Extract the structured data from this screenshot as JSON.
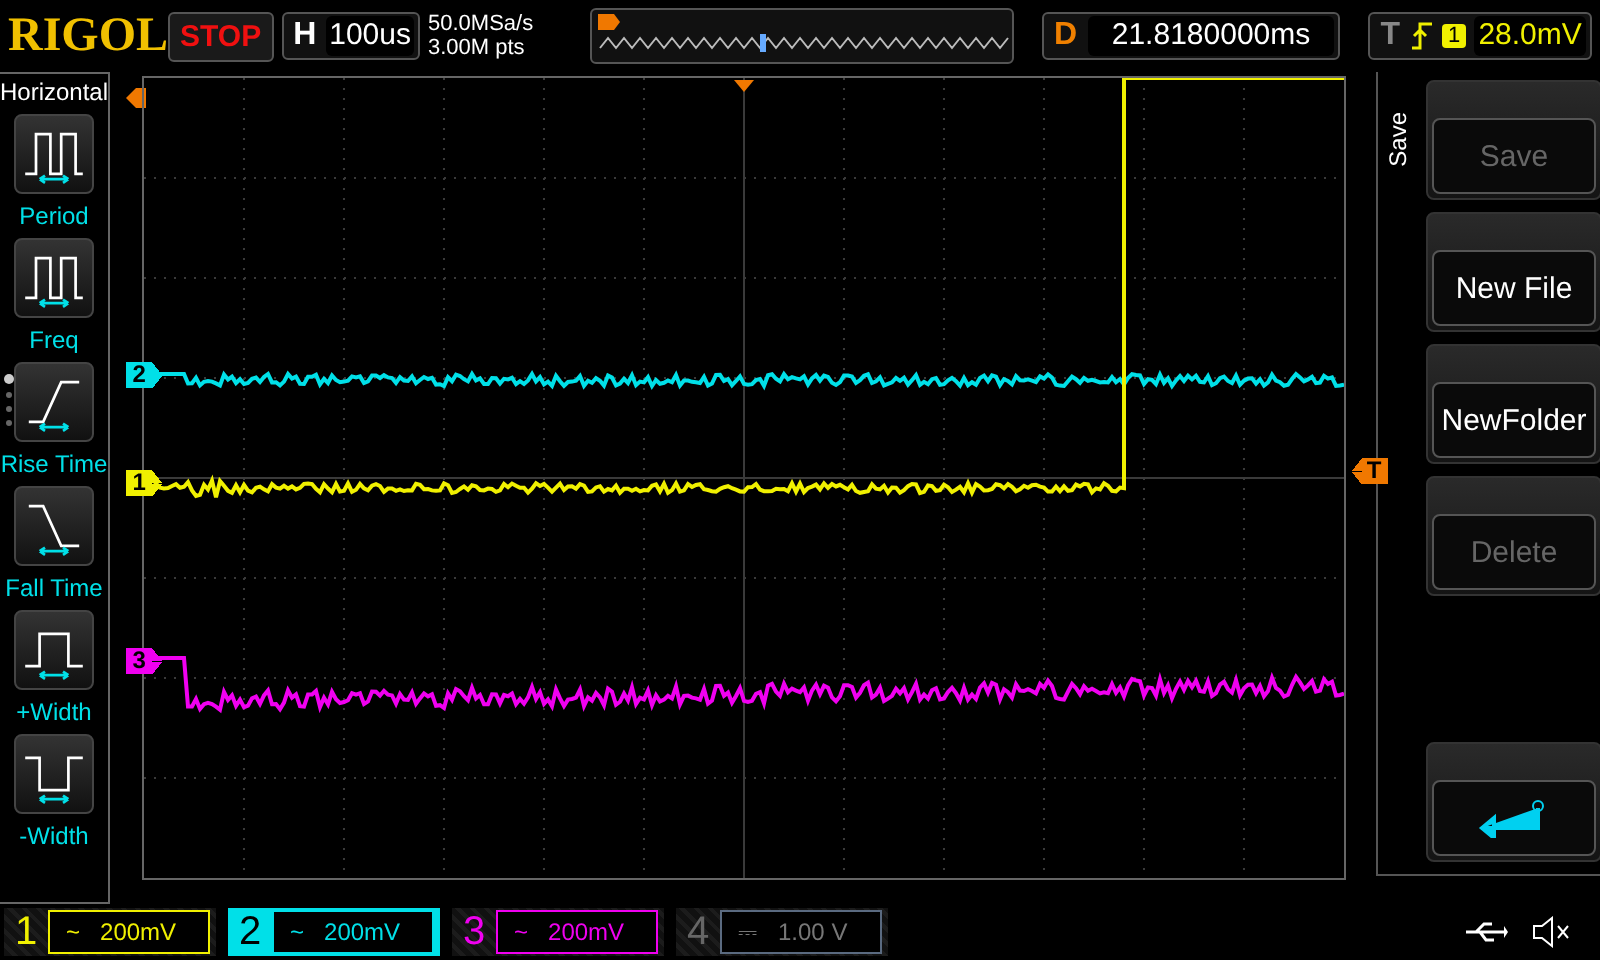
{
  "top_bar": {
    "logo": "RIGOL",
    "run_state": "STOP",
    "timebase": {
      "label": "H",
      "value": "100us"
    },
    "sample_rate": "50.0MSa/s",
    "memory_depth": "3.00M pts",
    "delay": {
      "label": "D",
      "value": "21.8180000ms"
    },
    "trigger": {
      "label": "T",
      "source": "1",
      "level": "28.0mV"
    }
  },
  "measure_panel": {
    "title": "Horizontal",
    "items": [
      {
        "label": "Period",
        "kind": "period"
      },
      {
        "label": "Freq",
        "kind": "freq"
      },
      {
        "label": "Rise Time",
        "kind": "rise"
      },
      {
        "label": "Fall Time",
        "kind": "fall"
      },
      {
        "label": "+Width",
        "kind": "pwidth"
      },
      {
        "label": "-Width",
        "kind": "nwidth"
      }
    ],
    "page_dots": [
      {
        "selected": true
      },
      {
        "selected": false
      },
      {
        "selected": false
      },
      {
        "selected": false
      }
    ]
  },
  "markers": [
    {
      "label": "2",
      "color": "#00e0e8"
    },
    {
      "label": "1",
      "color": "#f0f000"
    },
    {
      "label": "3",
      "color": "#f000f0"
    }
  ],
  "trigger_marker": {
    "label": "T"
  },
  "menu": {
    "title": "Save",
    "buttons": [
      {
        "label": "Save",
        "disabled": true
      },
      {
        "label": "New File",
        "disabled": false
      },
      {
        "label": "NewFolder",
        "disabled": false
      },
      {
        "label": "Delete",
        "disabled": true
      }
    ]
  },
  "channels": [
    {
      "number": "1",
      "coupling": "~",
      "scale": "200mV",
      "color": "#f0f000",
      "selected": false,
      "on": true
    },
    {
      "number": "2",
      "coupling": "~",
      "scale": "200mV",
      "color": "#00e0e8",
      "selected": true,
      "on": true
    },
    {
      "number": "3",
      "coupling": "~",
      "scale": "200mV",
      "color": "#f000f0",
      "selected": false,
      "on": true
    },
    {
      "number": "4",
      "coupling": "⎓",
      "scale": "1.00 V",
      "color": "#5a6a80",
      "selected": false,
      "on": false
    }
  ]
}
